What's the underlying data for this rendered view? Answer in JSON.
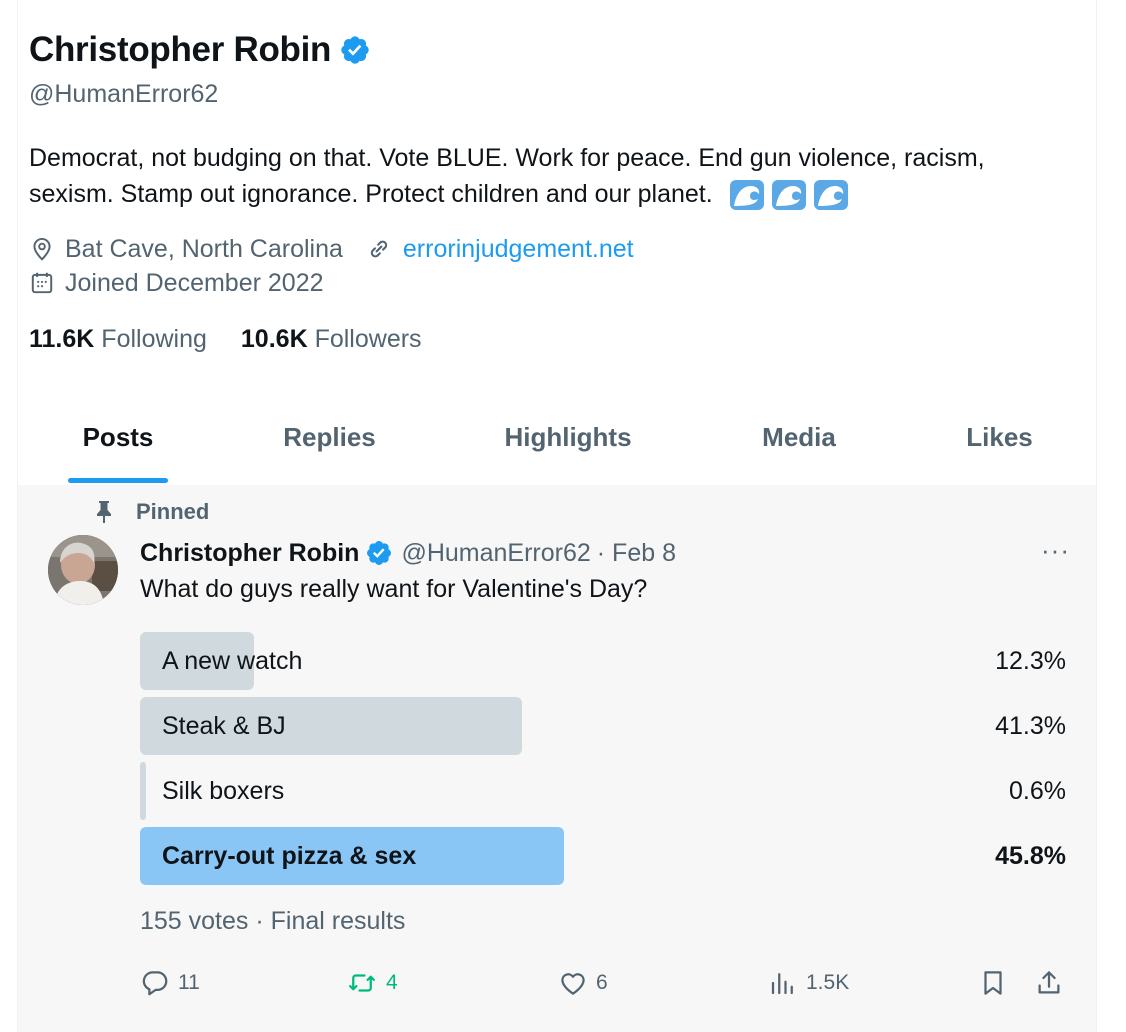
{
  "profile": {
    "name": "Christopher Robin",
    "handle": "@HumanError62",
    "bio": "Democrat, not budging on that. Vote BLUE. Work for peace. End gun violence, racism, sexism. Stamp out ignorance. Protect children and our planet.",
    "bio_emoji": [
      "water-wave-emoji",
      "water-wave-emoji",
      "water-wave-emoji"
    ],
    "location": "Bat Cave, North Carolina",
    "website": "errorinjudgement.net",
    "joined": "Joined December 2022",
    "following_count": "11.6K",
    "following_label": "Following",
    "followers_count": "10.6K",
    "followers_label": "Followers"
  },
  "tabs": [
    {
      "label": "Posts",
      "active": true
    },
    {
      "label": "Replies",
      "active": false
    },
    {
      "label": "Highlights",
      "active": false
    },
    {
      "label": "Media",
      "active": false
    },
    {
      "label": "Likes",
      "active": false
    }
  ],
  "post": {
    "pinned_label": "Pinned",
    "author_name": "Christopher Robin",
    "author_handle": "@HumanError62",
    "date": "· Feb 8",
    "more": "···",
    "text": "What do guys really want for Valentine's Day?",
    "poll": {
      "options": [
        {
          "label": "A new watch",
          "percent": "12.3%",
          "fraction": 0.123,
          "winner": false
        },
        {
          "label": "Steak & BJ",
          "percent": "41.3%",
          "fraction": 0.413,
          "winner": false
        },
        {
          "label": "Silk boxers",
          "percent": "0.6%",
          "fraction": 0.006,
          "winner": false
        },
        {
          "label": "Carry-out pizza & sex",
          "percent": "45.8%",
          "fraction": 0.458,
          "winner": true
        }
      ],
      "summary": "155 votes · Final results"
    },
    "actions": {
      "replies": "11",
      "reposts": "4",
      "likes": "6",
      "views": "1.5K"
    }
  },
  "colors": {
    "accent": "#1d9bf0",
    "repost": "#00ba7c",
    "poll_bar": "#cfd9de",
    "poll_winner_bar": "#8ac6f5",
    "secondary_text": "#536471"
  }
}
